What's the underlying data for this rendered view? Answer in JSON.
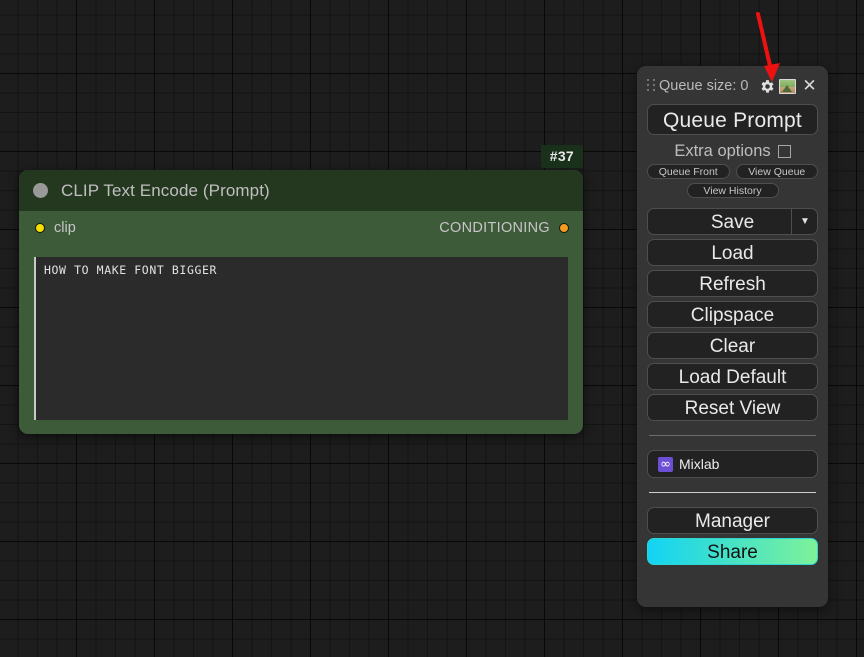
{
  "canvas": {
    "background_color": "#1d1d1d",
    "grid": "dot-grid"
  },
  "node": {
    "badge": "#37",
    "title": "CLIP Text Encode (Prompt)",
    "collapse_icon": "collapse-dot-icon",
    "title_color": "#24371f",
    "body_color": "#3d5a39",
    "inputs": [
      {
        "label": "clip",
        "dot_color": "#f6e000"
      }
    ],
    "outputs": [
      {
        "label": "CONDITIONING",
        "dot_color": "#f49c1e"
      }
    ],
    "text_widget": {
      "value": "HOW TO MAKE FONT BIGGER",
      "placeholder": ""
    }
  },
  "panel": {
    "drag_handle_icon": "drag-handle-icon",
    "queue_size_label": "Queue size: 0",
    "header_icons": [
      {
        "name": "gear-icon",
        "glyph": "⚙"
      },
      {
        "name": "image-icon",
        "glyph": ""
      },
      {
        "name": "close-icon",
        "glyph": "✕"
      }
    ],
    "queue_prompt_label": "Queue Prompt",
    "extra_options_label": "Extra options",
    "extra_options_checked": false,
    "queue_front_label": "Queue Front",
    "view_queue_label": "View Queue",
    "view_history_label": "View History",
    "save_label": "Save",
    "save_dropdown_icon": "chevron-down-icon",
    "load_label": "Load",
    "refresh_label": "Refresh",
    "clipspace_label": "Clipspace",
    "clear_label": "Clear",
    "load_default_label": "Load Default",
    "reset_view_label": "Reset View",
    "mixlab_label": "Mixlab",
    "mixlab_icon_glyph": "∞",
    "mixlab_icon_color": "#6d4fd6",
    "manager_label": "Manager",
    "share_label": "Share",
    "share_gradient_from": "#12d3f5",
    "share_gradient_to": "#7ef29a"
  },
  "annotation": {
    "arrow_color": "#ee1111",
    "points_to": "gear-icon"
  }
}
